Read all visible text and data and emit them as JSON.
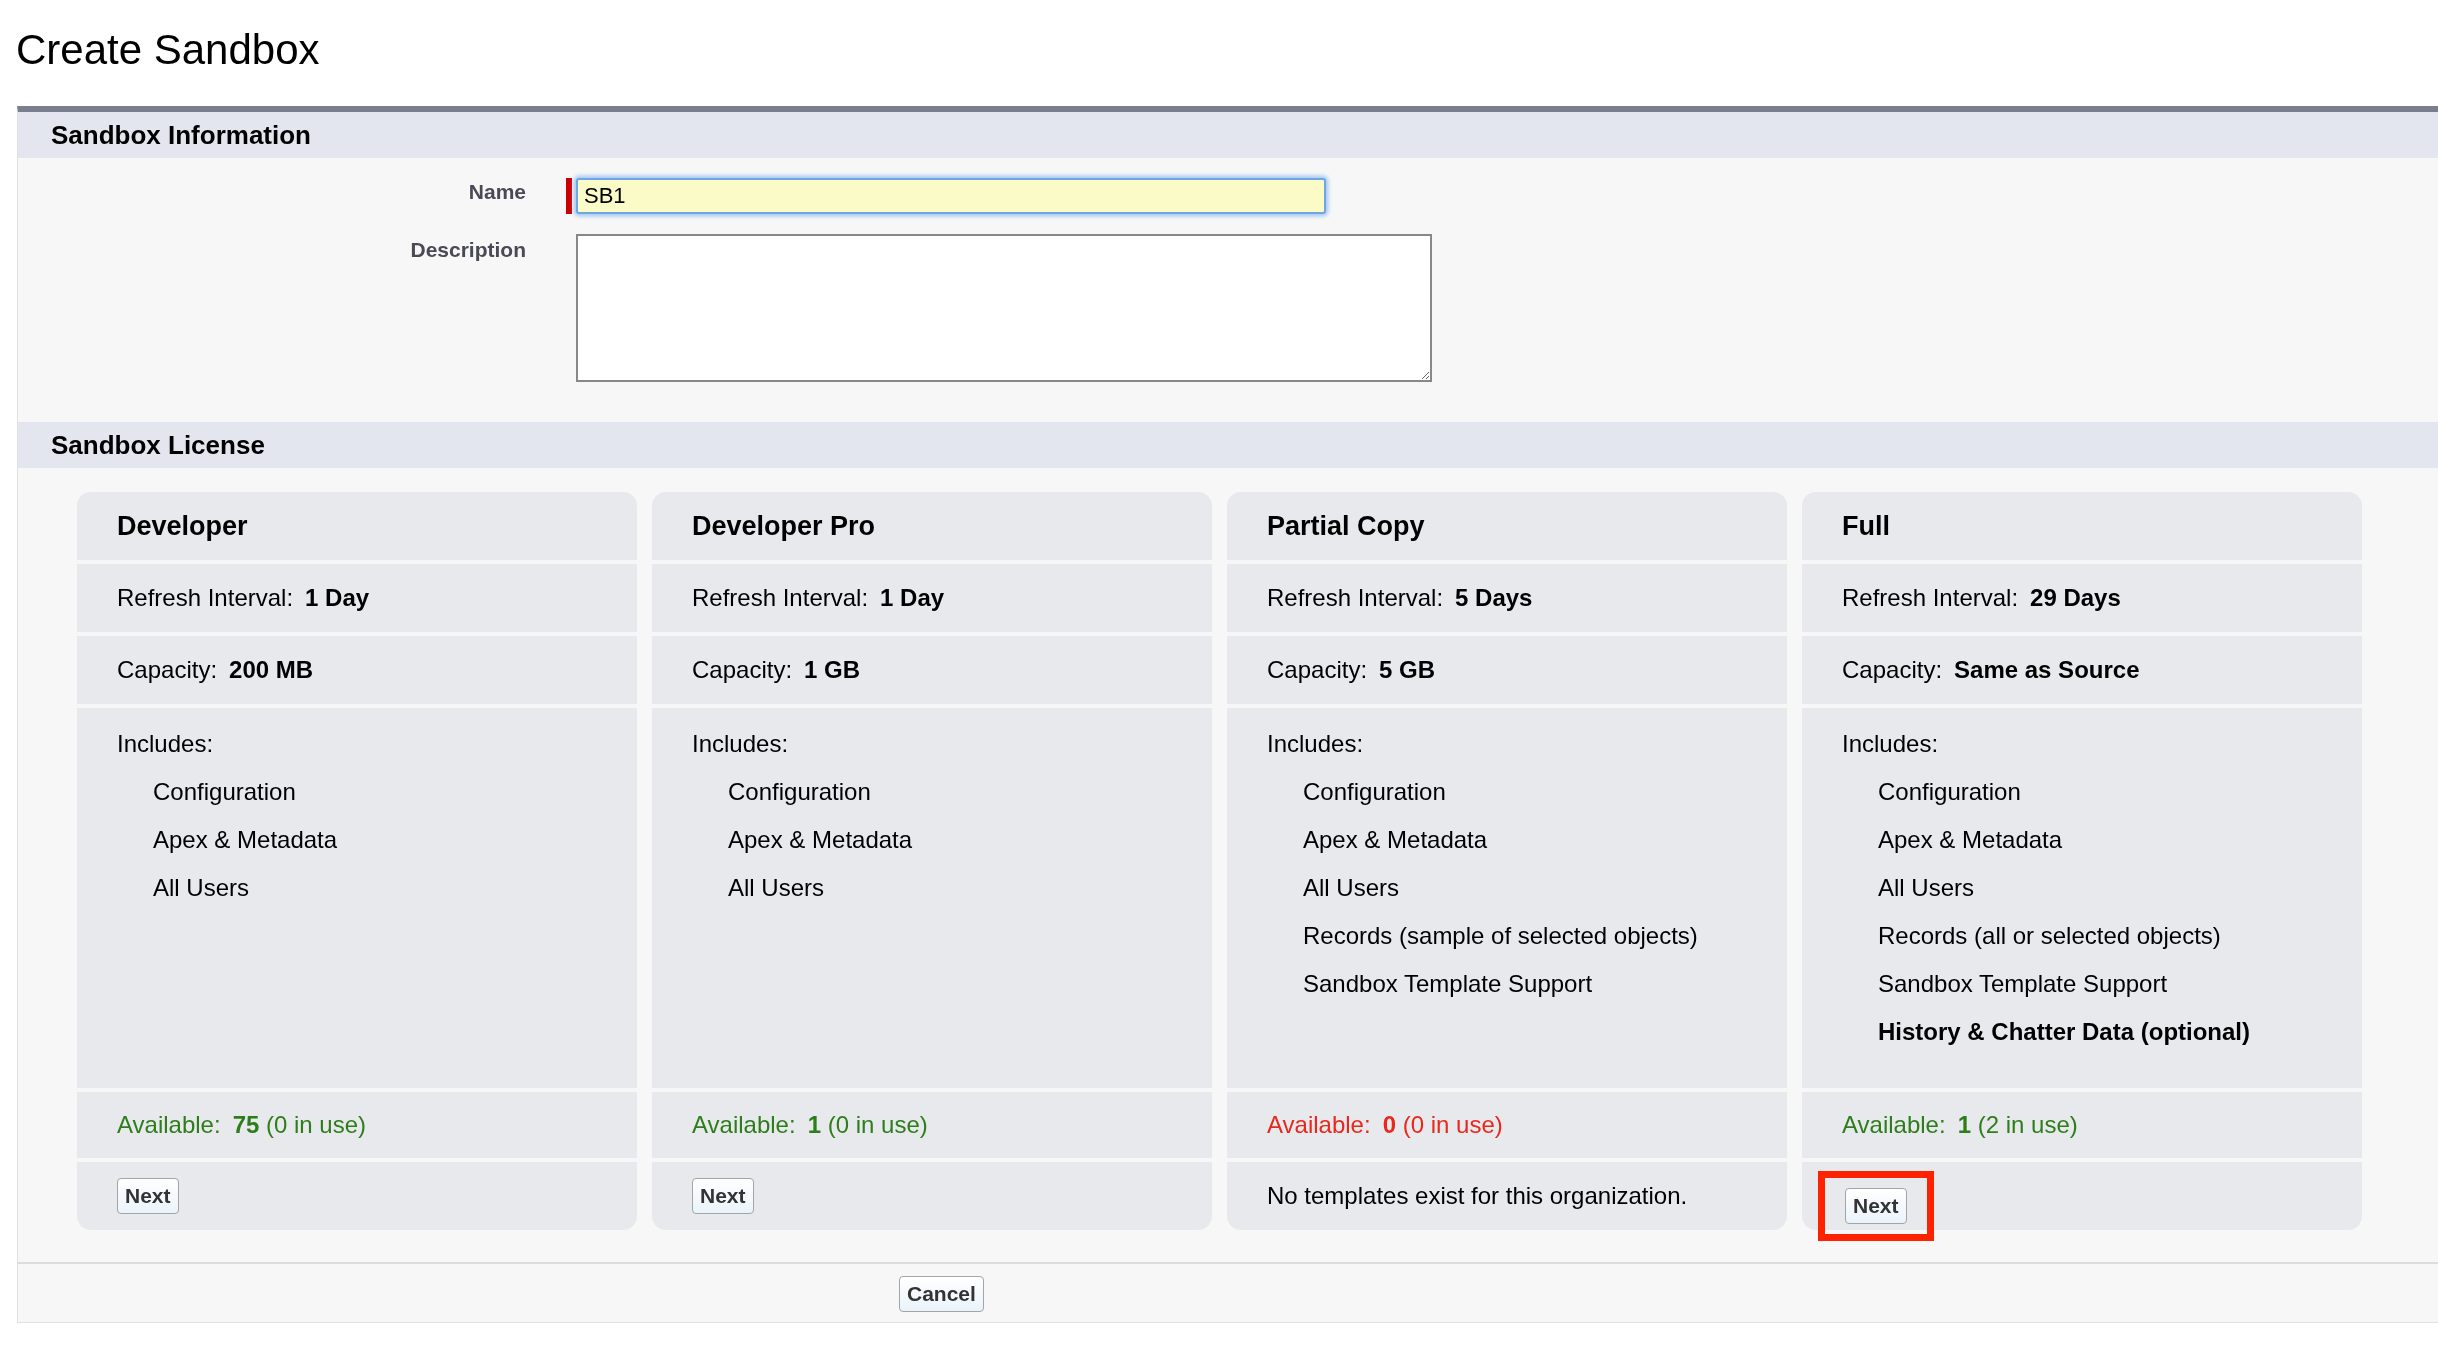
{
  "page_title": "Create Sandbox",
  "info_section": {
    "title": "Sandbox Information",
    "fields": [
      {
        "kind": "input",
        "label": "Name",
        "value": "SB1",
        "required": true,
        "focused": true
      },
      {
        "kind": "textarea",
        "label": "Description",
        "focused": false
      }
    ]
  },
  "license_section": {
    "title": "Sandbox License",
    "licenses": [
      {
        "name": "Developer",
        "refresh_label": "Refresh Interval:",
        "refresh": "1 Day",
        "capacity_label": "Capacity:",
        "capacity": "200 MB",
        "includes_label": "Includes:",
        "includes": [
          {
            "text": "Configuration",
            "emphasized": false
          },
          {
            "text": "Apex & Metadata",
            "emphasized": false
          },
          {
            "text": "All Users",
            "emphasized": false
          }
        ],
        "available_label": "Available:",
        "available": "75",
        "in_use": "(0 in use)",
        "color": "#2e7d1b",
        "action": {
          "kind": "button",
          "label": "Next",
          "highlighted": false
        }
      },
      {
        "name": "Developer Pro",
        "refresh_label": "Refresh Interval:",
        "refresh": "1 Day",
        "capacity_label": "Capacity:",
        "capacity": "1 GB",
        "includes_label": "Includes:",
        "includes": [
          {
            "text": "Configuration",
            "emphasized": false
          },
          {
            "text": "Apex & Metadata",
            "emphasized": false
          },
          {
            "text": "All Users",
            "emphasized": false
          }
        ],
        "available_label": "Available:",
        "available": "1",
        "in_use": "(0 in use)",
        "color": "#2e7d1b",
        "action": {
          "kind": "button",
          "label": "Next",
          "highlighted": false
        }
      },
      {
        "name": "Partial Copy",
        "refresh_label": "Refresh Interval:",
        "refresh": "5 Days",
        "capacity_label": "Capacity:",
        "capacity": "5 GB",
        "includes_label": "Includes:",
        "includes": [
          {
            "text": "Configuration",
            "emphasized": false
          },
          {
            "text": "Apex & Metadata",
            "emphasized": false
          },
          {
            "text": "All Users",
            "emphasized": false
          },
          {
            "text": "Records (sample of selected objects)",
            "emphasized": false
          },
          {
            "text": "Sandbox Template Support",
            "emphasized": false
          }
        ],
        "available_label": "Available:",
        "available": "0",
        "in_use": "(0 in use)",
        "color": "#e8281c",
        "action": {
          "kind": "note",
          "text": "No templates exist for this organization."
        }
      },
      {
        "name": "Full",
        "refresh_label": "Refresh Interval:",
        "refresh": "29 Days",
        "capacity_label": "Capacity:",
        "capacity": "Same as Source",
        "includes_label": "Includes:",
        "includes": [
          {
            "text": "Configuration",
            "emphasized": false
          },
          {
            "text": "Apex & Metadata",
            "emphasized": false
          },
          {
            "text": "All Users",
            "emphasized": false
          },
          {
            "text": "Records (all or selected objects)",
            "emphasized": false
          },
          {
            "text": "Sandbox Template Support",
            "emphasized": false
          },
          {
            "text": "History & Chatter Data (optional)",
            "emphasized": true
          }
        ],
        "available_label": "Available:",
        "available": "1",
        "in_use": "(2 in use)",
        "color": "#2e7d1b",
        "action": {
          "kind": "button",
          "label": "Next",
          "highlighted": true
        }
      }
    ]
  },
  "footer_buttons": [
    {
      "label": "Cancel"
    }
  ]
}
